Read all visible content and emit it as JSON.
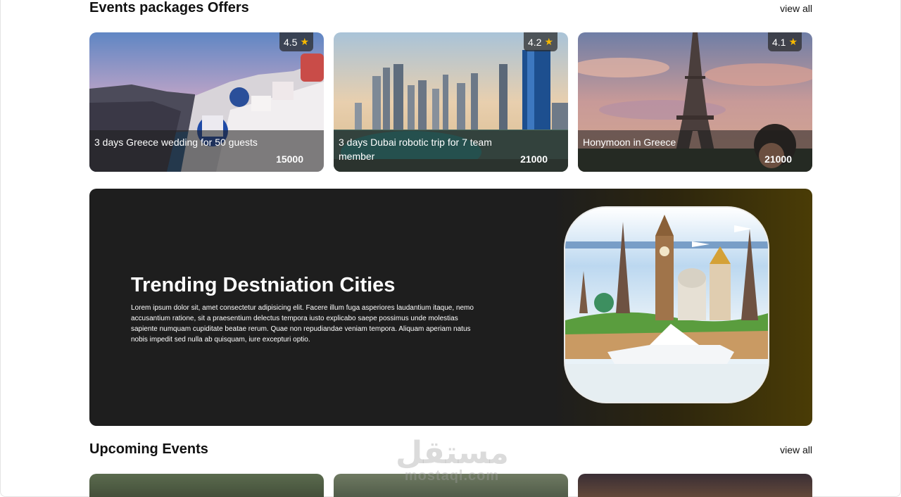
{
  "packages": {
    "title": "Events packages Offers",
    "view_all": "view all",
    "cards": [
      {
        "name": "3 days Greece wedding for 50 guests",
        "price": "15000",
        "rating": "4.5",
        "image": "santorini-photo"
      },
      {
        "name": "3 days Dubai robotic trip for 7 team member",
        "price": "21000",
        "rating": "4.2",
        "image": "dubai-skyline-photo"
      },
      {
        "name": "Honymoon in Greece",
        "price": "21000",
        "rating": "4.1",
        "image": "eiffel-tower-photo"
      }
    ]
  },
  "trending": {
    "title": "Trending Destniation Cities",
    "text": "Lorem ipsum dolor sit, amet consectetur adipisicing elit. Facere illum fuga asperiores laudantium itaque, nemo accusantium ratione, sit a praesentium delectus tempora iusto explicabo saepe possimus unde molestias sapiente numquam cupiditate beatae rerum. Quae non repudiandae veniam tempora. Aliquam aperiam natus nobis impedit sed nulla ab quisquam, iure excepturi optio.",
    "image": "world-landmarks-illustration"
  },
  "upcoming": {
    "title": "Upcoming Events",
    "view_all": "view all"
  },
  "watermark": {
    "arabic": "مستقل",
    "latin": "mostaql.com"
  },
  "colors": {
    "banner_dark": "#1e1e1e",
    "banner_gold": "#4a3c06",
    "star": "#f5b800"
  }
}
